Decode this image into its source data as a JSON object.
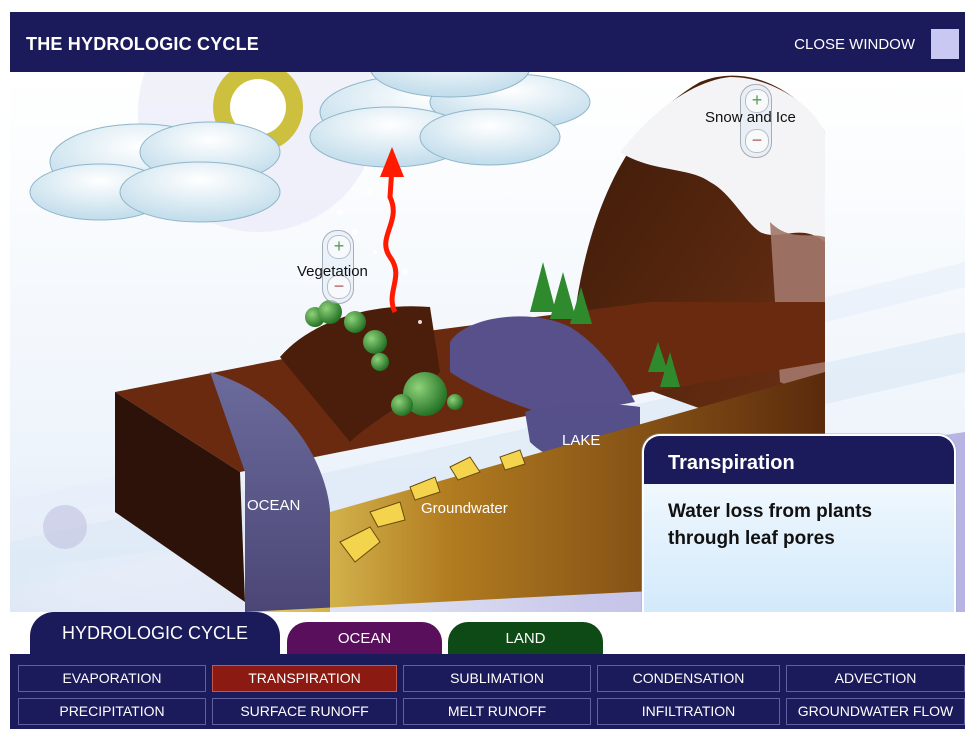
{
  "header": {
    "title": "THE HYDROLOGIC CYCLE",
    "close_label": "CLOSE WINDOW"
  },
  "scene": {
    "labels": {
      "snow": "Snow and Ice",
      "vegetation": "Vegetation",
      "lake": "LAKE",
      "ocean": "OCEAN",
      "groundwater": "Groundwater"
    },
    "zoom": {
      "plus": "+",
      "minus": "−"
    }
  },
  "info": {
    "title": "Transpiration",
    "body_line1": "Water loss from plants",
    "body_line2": "through leaf pores"
  },
  "tabs": {
    "hydrologic": "HYDROLOGIC CYCLE",
    "ocean": "OCEAN",
    "land": "LAND"
  },
  "nav": {
    "row1": [
      "EVAPORATION",
      "TRANSPIRATION",
      "SUBLIMATION",
      "CONDENSATION",
      "ADVECTION"
    ],
    "row2": [
      "PRECIPITATION",
      "SURFACE RUNOFF",
      "MELT RUNOFF",
      "INFILTRATION",
      "GROUNDWATER FLOW"
    ],
    "active": "TRANSPIRATION"
  },
  "colors": {
    "navy": "#1b1a5a",
    "active_button": "#8a1a12",
    "ocean_tab": "#5a0f5c",
    "land_tab": "#0e4a16",
    "transpiration_arrow": "#ff1a00"
  }
}
